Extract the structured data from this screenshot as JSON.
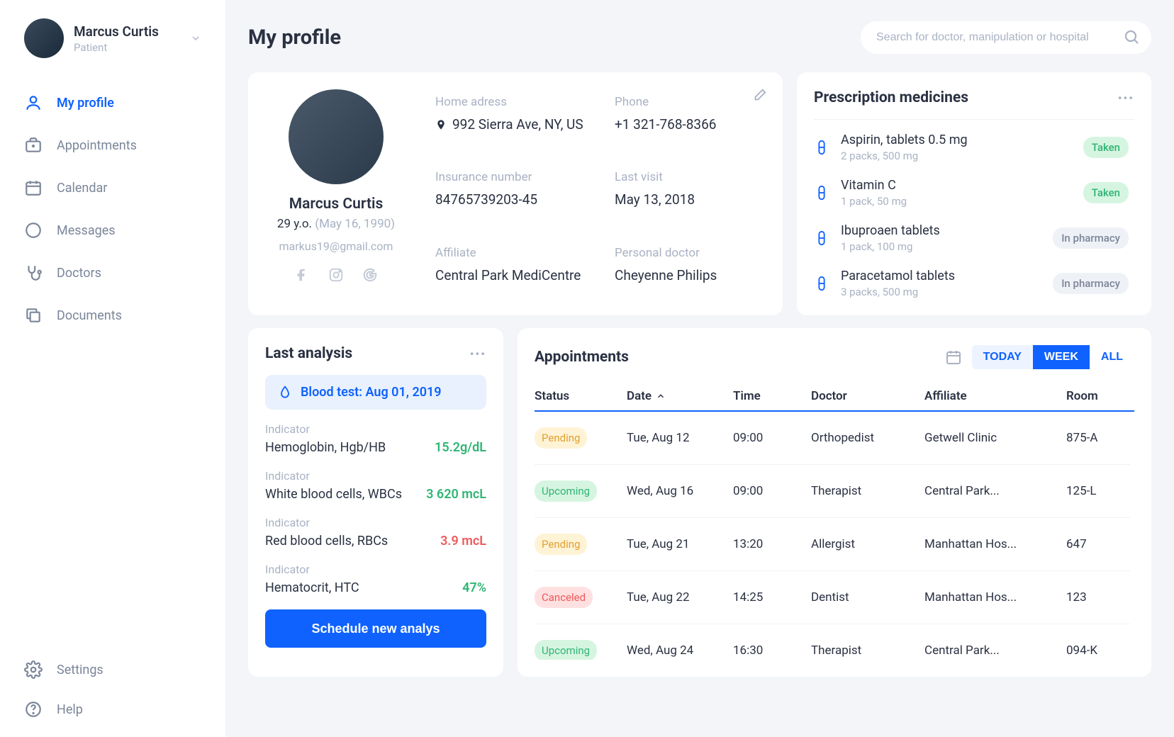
{
  "user": {
    "name": "Marcus Curtis",
    "role": "Patient"
  },
  "nav": {
    "items": [
      {
        "label": "My profile",
        "icon": "user",
        "active": true
      },
      {
        "label": "Appointments",
        "icon": "briefcase",
        "active": false
      },
      {
        "label": "Calendar",
        "icon": "calendar",
        "active": false
      },
      {
        "label": "Messages",
        "icon": "chat",
        "active": false
      },
      {
        "label": "Doctors",
        "icon": "stethoscope",
        "active": false
      },
      {
        "label": "Documents",
        "icon": "copy",
        "active": false
      }
    ],
    "bottom": [
      {
        "label": "Settings",
        "icon": "gear"
      },
      {
        "label": "Help",
        "icon": "help"
      }
    ]
  },
  "page_title": "My profile",
  "search": {
    "placeholder": "Search for doctor, manipulation or hospital"
  },
  "profile": {
    "name": "Marcus Curtis",
    "age": "29 y.o.",
    "dob": "(May 16, 1990)",
    "email": "markus19@gmail.com",
    "fields": {
      "home_label": "Home adress",
      "home_value": "992 Sierra Ave, NY, US",
      "phone_label": "Phone",
      "phone_value": "+1 321-768-8366",
      "insurance_label": "Insurance number",
      "insurance_value": "84765739203-45",
      "lastvisit_label": "Last visit",
      "lastvisit_value": "May 13, 2018",
      "affiliate_label": "Affiliate",
      "affiliate_value": "Central Park MediCentre",
      "doctor_label": "Personal doctor",
      "doctor_value": "Cheyenne Philips"
    }
  },
  "prescriptions": {
    "title": "Prescription medicines",
    "items": [
      {
        "name": "Aspirin, tablets 0.5 mg",
        "meta": "2 packs, 500 mg",
        "status": "Taken",
        "klass": "taken"
      },
      {
        "name": "Vitamin C",
        "meta": "1 pack, 50 mg",
        "status": "Taken",
        "klass": "taken"
      },
      {
        "name": "Ibuproaen tablets",
        "meta": "1 pack, 100 mg",
        "status": "In pharmacy",
        "klass": "pharm"
      },
      {
        "name": "Paracetamol tablets",
        "meta": "3 packs, 500 mg",
        "status": "In pharmacy",
        "klass": "pharm"
      }
    ]
  },
  "analysis": {
    "title": "Last analysis",
    "chip": "Blood test: Aug 01, 2019",
    "indicator_label": "Indicator",
    "items": [
      {
        "name": "Hemoglobin, Hgb/HB",
        "value": "15.2g/dL",
        "tone": "green"
      },
      {
        "name": "White blood cells, WBCs",
        "value": "3 620 mcL",
        "tone": "green"
      },
      {
        "name": "Red blood cells, RBCs",
        "value": "3.9 mcL",
        "tone": "red"
      },
      {
        "name": "Hematocrit, HTC",
        "value": "47%",
        "tone": "green"
      }
    ],
    "button": "Schedule new analys"
  },
  "appointments": {
    "title": "Appointments",
    "tabs": {
      "today": "TODAY",
      "week": "WEEK",
      "all": "ALL"
    },
    "columns": {
      "status": "Status",
      "date": "Date",
      "time": "Time",
      "doctor": "Doctor",
      "affiliate": "Affiliate",
      "room": "Room"
    },
    "rows": [
      {
        "status": "Pending",
        "klass": "pending",
        "date": "Tue, Aug 12",
        "time": "09:00",
        "doctor": "Orthopedist",
        "affiliate": "Getwell Clinic",
        "room": "875-A"
      },
      {
        "status": "Upcoming",
        "klass": "upcoming",
        "date": "Wed, Aug 16",
        "time": "09:00",
        "doctor": "Therapist",
        "affiliate": "Central Park...",
        "room": "125-L"
      },
      {
        "status": "Pending",
        "klass": "pending",
        "date": "Tue, Aug 21",
        "time": "13:20",
        "doctor": "Allergist",
        "affiliate": "Manhattan Hos...",
        "room": "647"
      },
      {
        "status": "Canceled",
        "klass": "canceled",
        "date": "Tue, Aug 22",
        "time": "14:25",
        "doctor": "Dentist",
        "affiliate": "Manhattan Hos...",
        "room": "123"
      },
      {
        "status": "Upcoming",
        "klass": "upcoming",
        "date": "Wed, Aug 24",
        "time": "16:30",
        "doctor": "Therapist",
        "affiliate": "Central Park...",
        "room": "094-K"
      }
    ]
  }
}
